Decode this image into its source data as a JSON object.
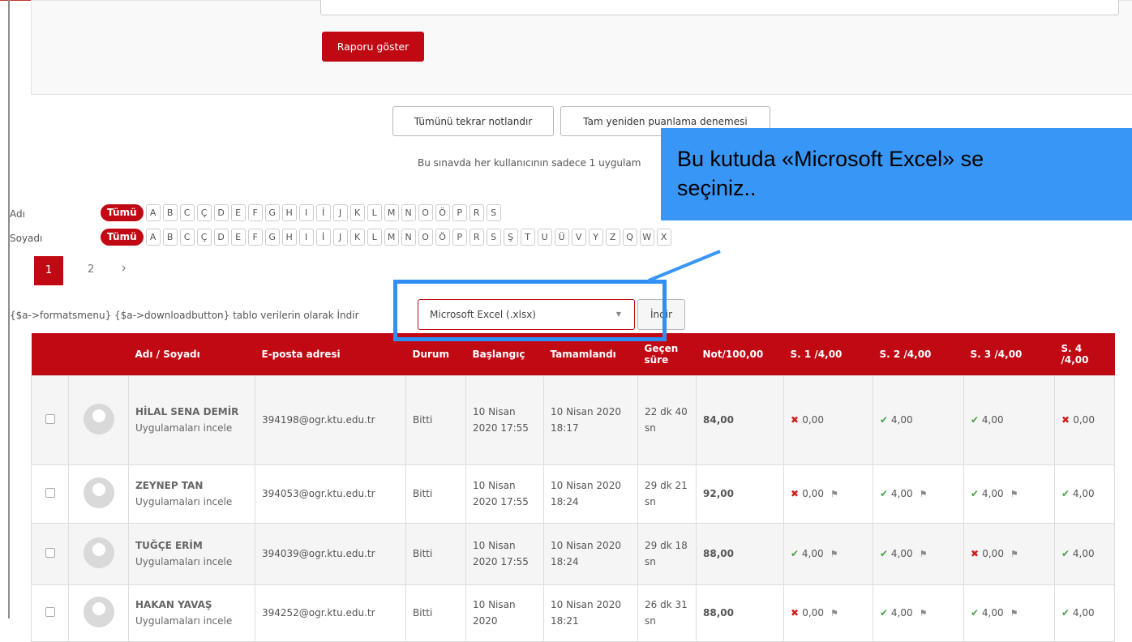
{
  "form": {
    "report_button": "Raporu göster"
  },
  "actions": {
    "regrade_all": "Tümünü tekrar notlandır",
    "full_regrade": "Tam yeniden puanlama denemesi"
  },
  "info_text": "Bu sınavda her kullanıcının sadece 1 uygulam",
  "initials": {
    "first_label": "Adı",
    "last_label": "Soyadı",
    "all_label": "Tümü",
    "first_letters": [
      "A",
      "B",
      "C",
      "Ç",
      "D",
      "E",
      "F",
      "G",
      "H",
      "I",
      "İ",
      "J",
      "K",
      "L",
      "M",
      "N",
      "O",
      "Ö",
      "P",
      "R",
      "S"
    ],
    "last_letters": [
      "A",
      "B",
      "C",
      "Ç",
      "D",
      "E",
      "F",
      "G",
      "H",
      "I",
      "İ",
      "J",
      "K",
      "L",
      "M",
      "N",
      "O",
      "Ö",
      "P",
      "R",
      "S",
      "Ş",
      "T",
      "U",
      "Ü",
      "V",
      "Y",
      "Z",
      "Q",
      "W",
      "X"
    ]
  },
  "pagination": {
    "current": "1",
    "next": "2",
    "next_icon": "chevron-right-icon"
  },
  "download": {
    "label": "{$a->formatsmenu} {$a->downloadbutton} tablo verilerin olarak İndir",
    "format_value": "Microsoft Excel (.xlsx)",
    "button": "İndir"
  },
  "callout": {
    "line1": "Bu kutuda «Microsoft Excel» se",
    "line2": "seçiniz.."
  },
  "table": {
    "headers": {
      "name": "Adı / Soyadı",
      "email": "E-posta adresi",
      "status": "Durum",
      "start": "Başlangıç",
      "finish": "Tamamlandı",
      "elapsed": "Geçen süre",
      "grade": "Not/100,00",
      "q1": "S. 1 /4,00",
      "q2": "S. 2 /4,00",
      "q3": "S. 3 /4,00",
      "q4": "S. 4 /4,00"
    },
    "review_link": "Uygulamaları incele",
    "rows": [
      {
        "name": "HİLAL SENA DEMİR",
        "email": "394198@ogr.ktu.edu.tr",
        "status": "Bitti",
        "start": "10 Nisan 2020 17:55",
        "finish": "10 Nisan 2020 18:17",
        "elapsed": "22 dk 40 sn",
        "grade": "84,00",
        "q": [
          [
            "x",
            "0,00"
          ],
          [
            "ok",
            "4,00"
          ],
          [
            "ok",
            "4,00"
          ],
          [
            "x",
            "0,00"
          ]
        ],
        "flags": false
      },
      {
        "name": "ZEYNEP TAN",
        "email": "394053@ogr.ktu.edu.tr",
        "status": "Bitti",
        "start": "10 Nisan 2020 17:55",
        "finish": "10 Nisan 2020 18:24",
        "elapsed": "29 dk 21 sn",
        "grade": "92,00",
        "q": [
          [
            "x",
            "0,00"
          ],
          [
            "ok",
            "4,00"
          ],
          [
            "ok",
            "4,00"
          ],
          [
            "ok",
            "4,00"
          ]
        ],
        "flags": true
      },
      {
        "name": "TUĞÇE ERİM",
        "email": "394039@ogr.ktu.edu.tr",
        "status": "Bitti",
        "start": "10 Nisan 2020 17:55",
        "finish": "10 Nisan 2020 18:24",
        "elapsed": "29 dk 18 sn",
        "grade": "88,00",
        "q": [
          [
            "ok",
            "4,00"
          ],
          [
            "ok",
            "4,00"
          ],
          [
            "x",
            "0,00"
          ],
          [
            "ok",
            "4,00"
          ]
        ],
        "flags": true
      },
      {
        "name": "HAKAN YAVAŞ",
        "email": "394252@ogr.ktu.edu.tr",
        "status": "Bitti",
        "start": "10 Nisan 2020",
        "finish": "10 Nisan 2020 18:21",
        "elapsed": "26 dk 31 sn",
        "grade": "88,00",
        "q": [
          [
            "x",
            "0,00"
          ],
          [
            "ok",
            "4,00"
          ],
          [
            "ok",
            "4,00"
          ],
          [
            "ok",
            "4,00"
          ]
        ],
        "flags": true
      }
    ]
  },
  "colors": {
    "accent_red": "#c10914",
    "callout_blue": "#3897f6",
    "highlight_blue": "#2f8ff6"
  }
}
